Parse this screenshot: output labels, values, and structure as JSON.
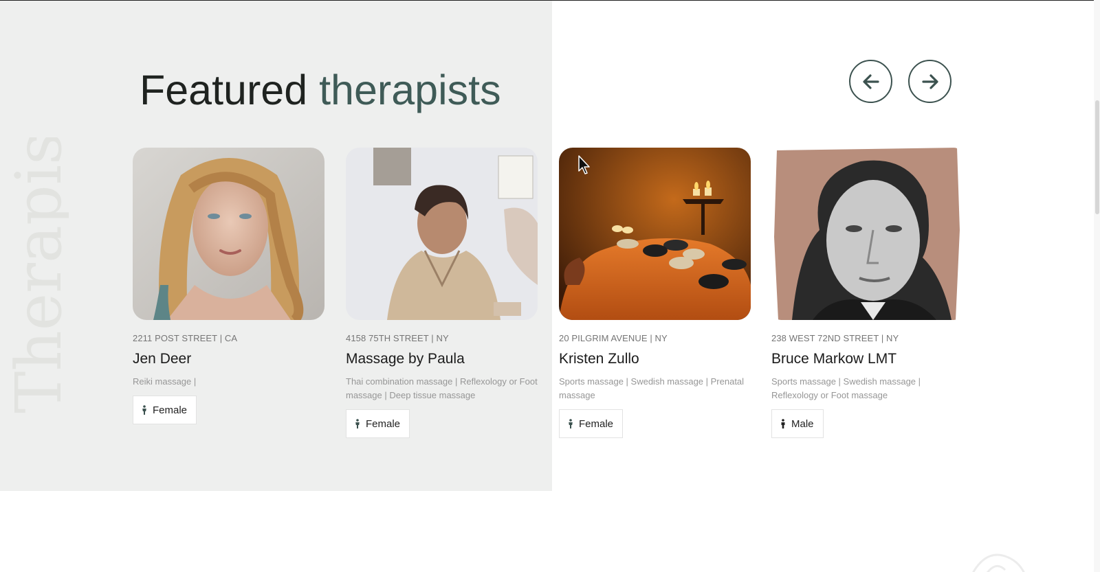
{
  "section": {
    "background_word": "Therapists",
    "heading_plain": "Featured ",
    "heading_accent": "therapists",
    "accent_color": "#3f5b57"
  },
  "carousel": {
    "prev_icon": "arrow-left-icon",
    "next_icon": "arrow-right-icon"
  },
  "therapists": [
    {
      "address": "2211 POST STREET | CA",
      "name": "Jen Deer",
      "services": "Reiki massage |",
      "gender": "Female",
      "photo": "woman-blonde-portrait"
    },
    {
      "address": "4158 75TH STREET | NY",
      "name": "Massage by Paula",
      "services": "Thai combination massage | Reflexology or Foot massage | Deep tissue massage",
      "gender": "Female",
      "photo": "woman-seated-portrait"
    },
    {
      "address": "20 PILGRIM AVENUE | NY",
      "name": "Kristen Zullo",
      "services": "Sports massage | Swedish massage | Prenatal massage",
      "gender": "Female",
      "photo": "hot-stone-massage-candles"
    },
    {
      "address": "238 WEST 72ND STREET | NY",
      "name": "Bruce Markow LMT",
      "services": "Sports massage | Swedish massage | Reflexology or Foot massage",
      "gender": "Male",
      "photo": "man-bw-portrait"
    }
  ]
}
